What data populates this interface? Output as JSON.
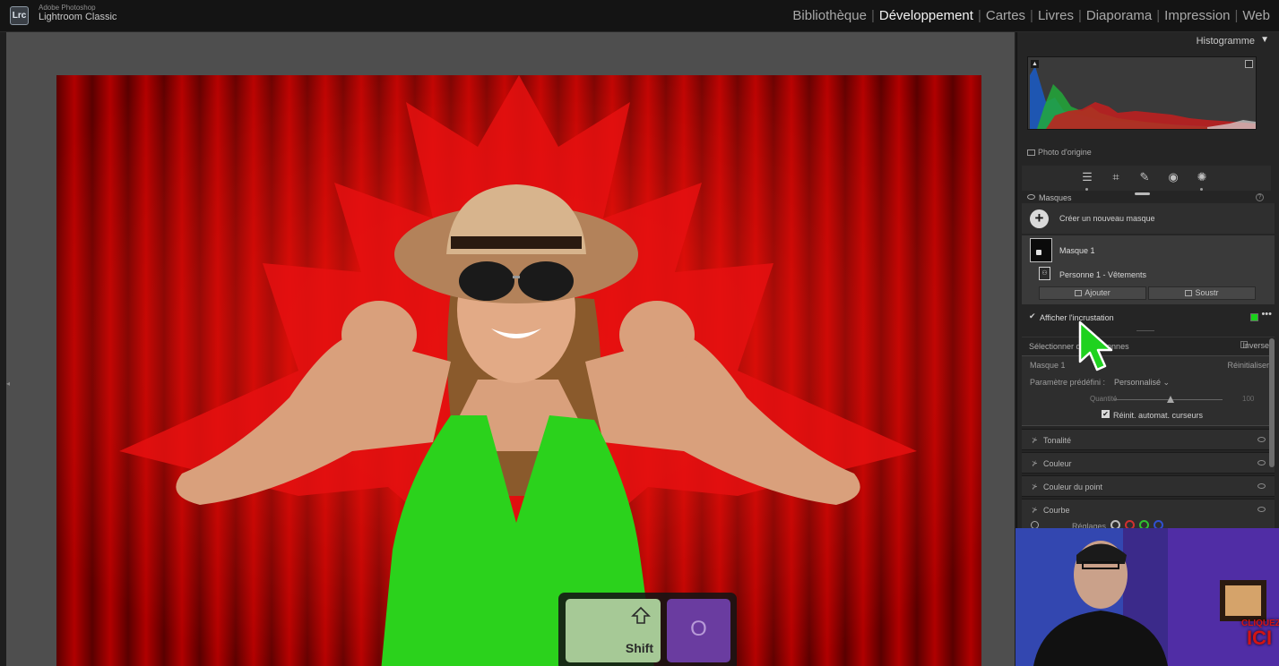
{
  "app": {
    "vendor": "Adobe Photoshop",
    "product": "Lightroom Classic",
    "logo_text": "Lrc"
  },
  "modules": [
    {
      "label": "Bibliothèque",
      "active": false
    },
    {
      "label": "Développement",
      "active": true
    },
    {
      "label": "Cartes",
      "active": false
    },
    {
      "label": "Livres",
      "active": false
    },
    {
      "label": "Diaporama",
      "active": false
    },
    {
      "label": "Impression",
      "active": false
    },
    {
      "label": "Web",
      "active": false
    }
  ],
  "module_separator": "|",
  "histogram": {
    "title": "Histogramme",
    "collapse_arrow": "▼",
    "clip_left_glyph": "▲",
    "original_photo_label": "Photo d'origine"
  },
  "tools": [
    {
      "name": "edit-sliders",
      "glyph": "☰"
    },
    {
      "name": "crop",
      "glyph": "⌗"
    },
    {
      "name": "healing",
      "glyph": "✎"
    },
    {
      "name": "red-eye",
      "glyph": "◉"
    },
    {
      "name": "masking",
      "glyph": "✺"
    }
  ],
  "masks_panel": {
    "title": "Masques",
    "help_glyph": "?",
    "create_label": "Créer un nouveau masque",
    "create_glyph": "+",
    "mask_name": "Masque 1",
    "component_label": "Personne 1 - Vêtements",
    "add_label": "Ajouter",
    "subtract_label": "Soustr",
    "show_overlay_label": "Afficher l'incrustation",
    "overlay_checked_glyph": "✔",
    "overlay_color": "#19d219",
    "more_glyph": "•••",
    "select_people_label": "Sélectionner des personnes",
    "invert_label": "Inverser"
  },
  "mask_settings": {
    "title": "Masque 1",
    "reset_label": "Réinitialiser",
    "preset_label": "Paramètre prédéfini :",
    "preset_value": "Personnalisé ⌄",
    "amount_label": "Quantité",
    "amount_value": "100",
    "auto_reset_label": "Réinit. automat. curseurs",
    "auto_reset_glyph": "✔"
  },
  "sections": [
    {
      "id": "tonalite",
      "label": "Tonalité"
    },
    {
      "id": "couleur",
      "label": "Couleur"
    },
    {
      "id": "point",
      "label": "Couleur du point"
    },
    {
      "id": "courbe",
      "label": "Courbe"
    }
  ],
  "section_arrow": "⊁",
  "curve": {
    "reglages_label": "Réglages",
    "channel_colors": [
      "#bdbdbd",
      "#d03030",
      "#30c030",
      "#3050d0"
    ]
  },
  "keys": {
    "shift_label": "Shift",
    "o_label": "O"
  },
  "webcam": {
    "cta_line1": "CLIQUEZ",
    "cta_line2": "ICI"
  }
}
